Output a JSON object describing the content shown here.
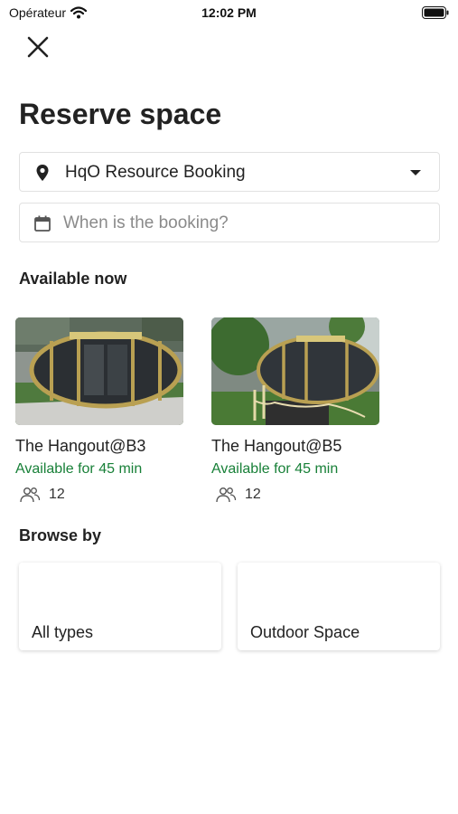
{
  "status_bar": {
    "carrier": "Opérateur",
    "time": "12:02 PM"
  },
  "page": {
    "title": "Reserve space"
  },
  "location_field": {
    "value": "HqO Resource Booking"
  },
  "date_field": {
    "placeholder": "When is the booking?"
  },
  "available_now": {
    "heading": "Available now",
    "spaces": [
      {
        "name": "The Hangout@B3",
        "availability": "Available for 45 min",
        "capacity": "12"
      },
      {
        "name": "The Hangout@B5",
        "availability": "Available for 45 min",
        "capacity": "12"
      }
    ]
  },
  "browse_by": {
    "heading": "Browse by",
    "items": [
      {
        "label": "All types"
      },
      {
        "label": "Outdoor Space"
      }
    ]
  },
  "colors": {
    "availability_green": "#188038",
    "text_primary": "#222222",
    "border": "#e1e1e1"
  },
  "icons": [
    "wifi-icon",
    "battery-icon",
    "close-icon",
    "location-pin-icon",
    "chevron-down-icon",
    "calendar-icon",
    "people-icon"
  ]
}
